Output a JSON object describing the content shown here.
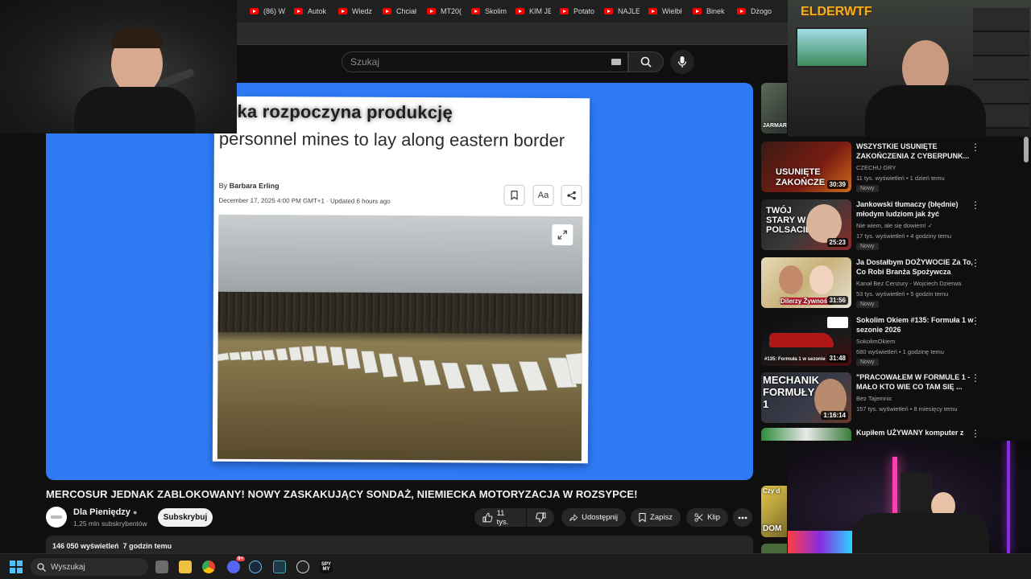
{
  "browser": {
    "tabs": [
      {
        "label": "(86) W"
      },
      {
        "label": "Autok"
      },
      {
        "label": "Wiedz"
      },
      {
        "label": "Chciał"
      },
      {
        "label": "MT20("
      },
      {
        "label": "Skolim"
      },
      {
        "label": "KIM JE"
      },
      {
        "label": "Potato"
      },
      {
        "label": "NAJLE"
      },
      {
        "label": "Wielbł"
      },
      {
        "label": "Binek"
      },
      {
        "label": "Dżogo"
      }
    ]
  },
  "overlay": {
    "logo_text": "ELDERWTF"
  },
  "search": {
    "placeholder": "Szukaj"
  },
  "icons": {
    "search": "search-icon",
    "mic": "mic-icon",
    "like": "thumbs-up-icon",
    "dislike": "thumbs-down-icon",
    "share": "share-icon",
    "save": "bookmark-icon",
    "clip": "scissors-icon",
    "more": "more-icon"
  },
  "article": {
    "title_top": "olska rozpoczyna produkcję",
    "title": "personnel mines to lay along eastern border",
    "by_prefix": "By",
    "author": "Barbara Erling",
    "dateline": "December 17, 2025 4:00 PM GMT+1 · Updated 6 hours ago",
    "text_size_label": "Aa"
  },
  "video": {
    "title": "MERCOSUR JEDNAK ZABLOKOWANY! NOWY ZASKAKUJĄCY SONDAŻ, NIEMIECKA MOTORYZACJA W ROZSYPCE!",
    "channel": "Dla Pieniędzy",
    "subscribers": "1,25 mln subskrybentów",
    "subscribe_label": "Subskrybuj",
    "likes": "11 tys.",
    "share_label": "Udostępnij",
    "save_label": "Zapisz",
    "clip_label": "Klip",
    "views": "146 050 wyświetleń",
    "posted": "7 godzin temu"
  },
  "recommended": [
    {
      "title": "WSZYSTKIE USUNIĘTE ZAKOŃCZENIA Z CYBERPUNK...",
      "channel": "CZECHU GRY",
      "meta": "11 tys. wyświetleń • 1 dzień temu",
      "badge": "Nowy",
      "duration": "30:39",
      "thumb_text": "USUNIĘTE ZAKOŃCZE",
      "thumb_color": "#7a1d12"
    },
    {
      "title": "Jankowski tłumaczy (błędnie) młodym ludziom jak żyć",
      "channel": "Nie wiem, ale się dowiem! ✓",
      "meta": "17 tys. wyświetleń • 4 godziny temu",
      "badge": "Nowy",
      "duration": "25:23",
      "thumb_text": "TWÓJ STARY W POLSACIE",
      "thumb_color": "#2a2a2a"
    },
    {
      "title": "Ja Dostałbym DOŻYWOCIE Za To, Co Robi Branża Spożywcza",
      "channel": "Kanał Bez Cenzury - Wojciech Dzierwa",
      "meta": "53 tys. wyświetleń • 5 godzin temu",
      "badge": "Nowy",
      "duration": "31:56",
      "thumb_text": "Dilerzy Żywności",
      "thumb_color": "#c8b27a"
    },
    {
      "title": "Sokolim Okiem #135: Formuła 1 w sezonie 2026",
      "channel": "SokolimOkiem",
      "meta": "680 wyświetleń • 1 godzinę temu",
      "badge": "Nowy",
      "duration": "31:48",
      "thumb_text": "#135: Formuła 1 w sezonie",
      "thumb_color": "#1a1a1a"
    },
    {
      "title": "\"PRACOWAŁEM W FORMULE 1 - MAŁO KTO WIE CO TAM SIĘ ...",
      "channel": "Bez Tajemnic",
      "meta": "157 tys. wyświetleń • 8 miesięcy temu",
      "badge": "",
      "duration": "1:16:14",
      "thumb_text": "MECHANIK FORMUŁY 1",
      "thumb_color": "#2b2d36"
    },
    {
      "title": "Kupiłem UŻYWANY komputer z OLX",
      "channel": "",
      "meta": "",
      "badge": "",
      "duration": "",
      "thumb_text": "",
      "thumb_color": "#3a7a3a"
    }
  ],
  "sidebar_partial": {
    "top_text": "JARMAR",
    "bottom_text": "Czy d",
    "bottom_text2": "DOM"
  },
  "taskbar": {
    "search_placeholder": "Wyszukaj",
    "discord_badge": "9+",
    "app_label": "SPY MY"
  }
}
